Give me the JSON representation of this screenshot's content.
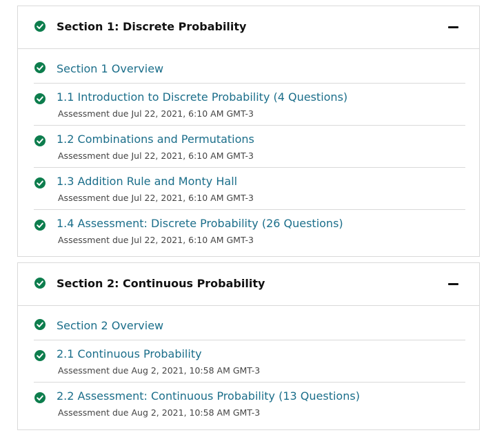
{
  "sections": [
    {
      "title": "Section 1: Discrete Probability",
      "items": [
        {
          "title": "Section 1 Overview",
          "subtitle": ""
        },
        {
          "title": "1.1 Introduction to Discrete Probability (4 Questions)",
          "subtitle": "Assessment due Jul 22, 2021, 6:10 AM GMT-3"
        },
        {
          "title": "1.2 Combinations and Permutations",
          "subtitle": "Assessment due Jul 22, 2021, 6:10 AM GMT-3"
        },
        {
          "title": "1.3 Addition Rule and Monty Hall",
          "subtitle": "Assessment due Jul 22, 2021, 6:10 AM GMT-3"
        },
        {
          "title": "1.4 Assessment: Discrete Probability (26 Questions)",
          "subtitle": "Assessment due Jul 22, 2021, 6:10 AM GMT-3"
        }
      ]
    },
    {
      "title": "Section 2: Continuous Probability",
      "items": [
        {
          "title": "Section 2 Overview",
          "subtitle": ""
        },
        {
          "title": "2.1 Continuous Probability",
          "subtitle": "Assessment due Aug 2, 2021, 10:58 AM GMT-3"
        },
        {
          "title": "2.2 Assessment: Continuous Probability (13 Questions)",
          "subtitle": "Assessment due Aug 2, 2021, 10:58 AM GMT-3"
        }
      ]
    }
  ],
  "icons": {
    "completed": "check-circle-icon",
    "collapse": "minus-icon"
  },
  "colors": {
    "check": "#0d7d4d",
    "link": "#1b6e8a",
    "border": "#d9d9d9"
  }
}
